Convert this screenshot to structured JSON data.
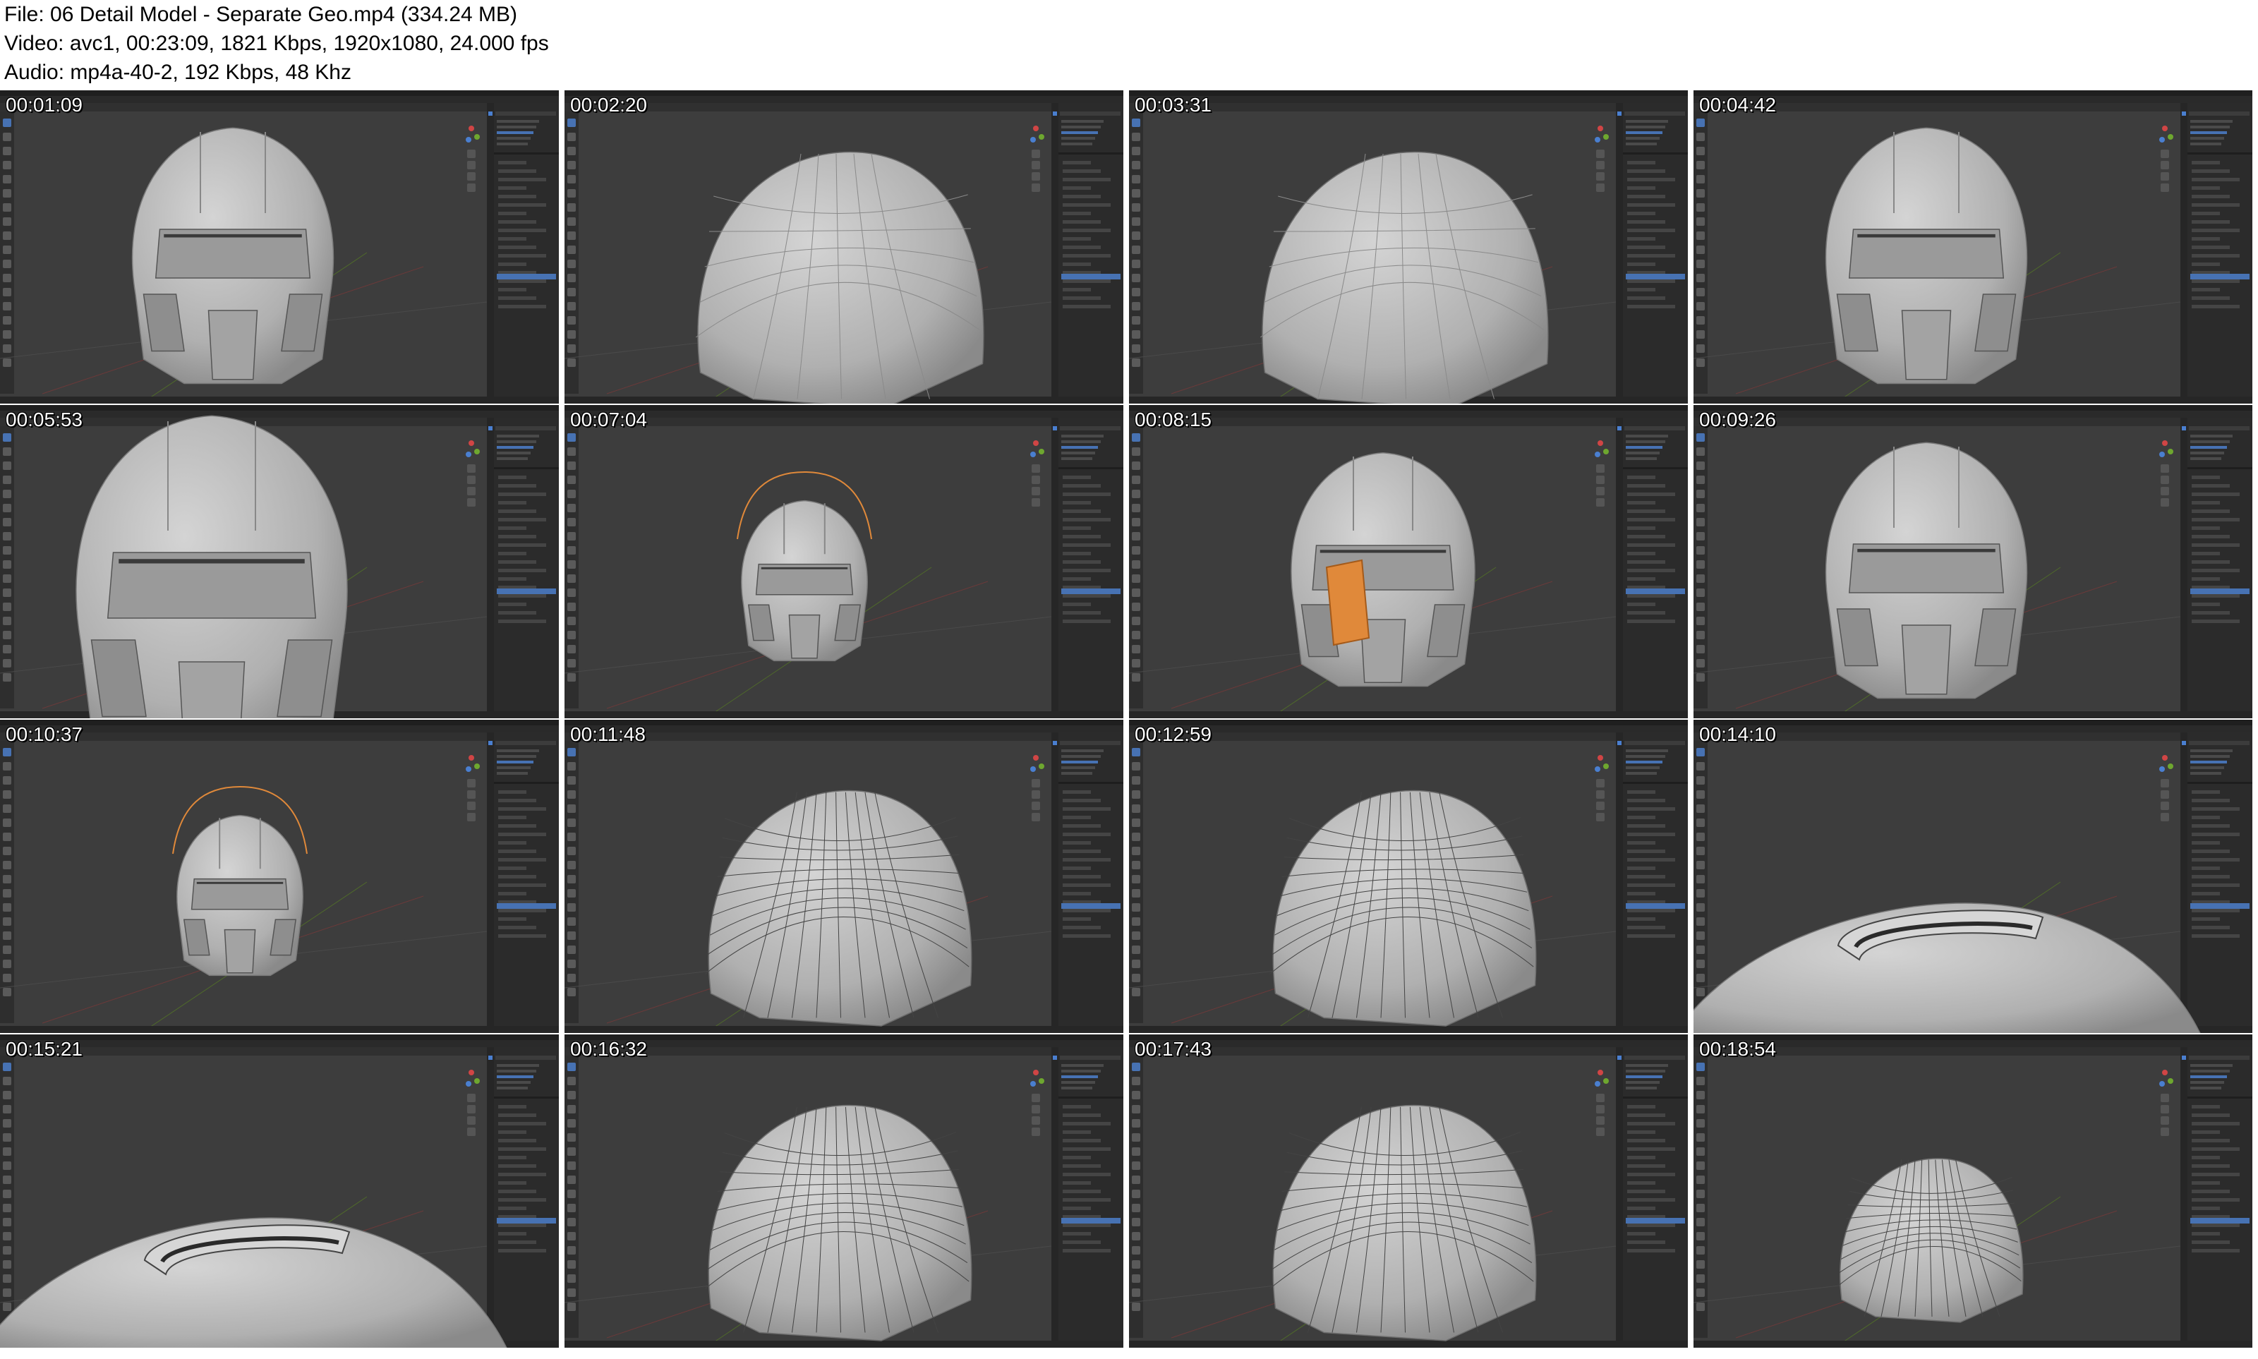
{
  "header": {
    "file": "File: 06  Detail Model - Separate Geo.mp4 (334.24 MB)",
    "video": "Video: avc1, 00:23:09, 1821 Kbps, 1920x1080, 24.000 fps",
    "audio": "Audio: mp4a-40-2, 192 Kbps, 48 Khz"
  },
  "colors": {
    "viewport": "#3d3d3d",
    "panel": "#2b2b2b",
    "model": "#b9b9b9",
    "selected": "#e0893a",
    "accent": "#4772b3"
  },
  "thumbnails": [
    {
      "time": "00:01:09",
      "model": "helmet-front"
    },
    {
      "time": "00:02:20",
      "model": "dome-side"
    },
    {
      "time": "00:03:31",
      "model": "dome-side"
    },
    {
      "time": "00:04:42",
      "model": "helmet-front"
    },
    {
      "time": "00:05:53",
      "model": "helmet-close"
    },
    {
      "time": "00:07:04",
      "model": "helmet-small-selected"
    },
    {
      "time": "00:08:15",
      "model": "helmet-orange-part"
    },
    {
      "time": "00:09:26",
      "model": "helmet-front"
    },
    {
      "time": "00:10:37",
      "model": "helmet-small-selected"
    },
    {
      "time": "00:11:48",
      "model": "dome-wire"
    },
    {
      "time": "00:12:59",
      "model": "dome-wire"
    },
    {
      "time": "00:14:10",
      "model": "visor-top"
    },
    {
      "time": "00:15:21",
      "model": "visor-top"
    },
    {
      "time": "00:16:32",
      "model": "dome-wire"
    },
    {
      "time": "00:17:43",
      "model": "dome-wire"
    },
    {
      "time": "00:18:54",
      "model": "dome-small"
    }
  ]
}
